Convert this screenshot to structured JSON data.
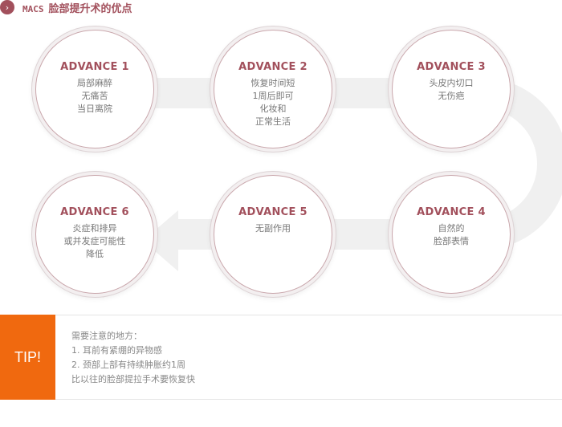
{
  "header": {
    "icon": "chevron-right-icon",
    "title_en": "MACS",
    "title_zh": "脸部提升术的优点"
  },
  "colors": {
    "accent": "#a2505c",
    "tip": "#f0690f",
    "track": "#f0f0f0"
  },
  "steps": [
    {
      "title": "ADVANCE 1",
      "lines": [
        "局部麻醉",
        "无痛苦",
        "当日离院"
      ]
    },
    {
      "title": "ADVANCE 2",
      "lines": [
        "恢复时间短",
        "1周后即可",
        "化妆和",
        "正常生活"
      ]
    },
    {
      "title": "ADVANCE 3",
      "lines": [
        "头皮内切口",
        "无伤疤"
      ]
    },
    {
      "title": "ADVANCE 4",
      "lines": [
        "自然的",
        "脸部表情"
      ]
    },
    {
      "title": "ADVANCE 5",
      "lines": [
        "无副作用"
      ]
    },
    {
      "title": "ADVANCE 6",
      "lines": [
        "炎症和排异",
        "或并发症可能性",
        "降低"
      ]
    }
  ],
  "tip": {
    "label": "TIP!",
    "heading": "需要注意的地方：",
    "items": [
      "1.   耳前有紧绷的异物感",
      "2.   颈部上部有持续肿胀约1周"
    ],
    "footer": "比以往的脸部提拉手术要恢复快"
  }
}
